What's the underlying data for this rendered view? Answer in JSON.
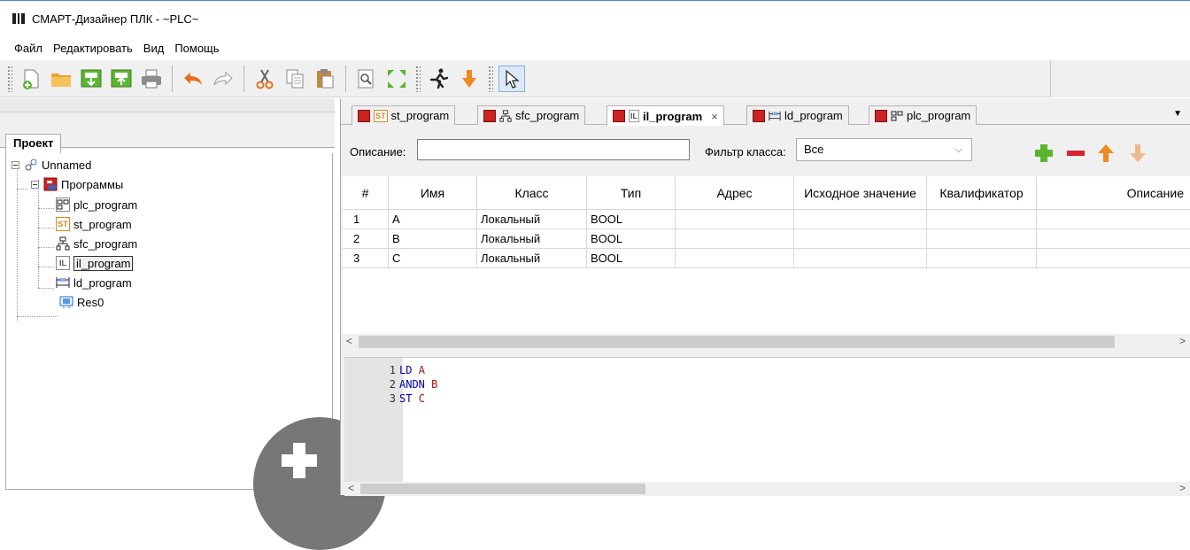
{
  "window": {
    "title": "СМАРТ-Дизайнер ПЛК - ~PLC~"
  },
  "menu": [
    "Файл",
    "Редактировать",
    "Вид",
    "Помощь"
  ],
  "toolbar": {
    "buttons": [
      "new-file-icon",
      "open-folder-icon",
      "download-icon",
      "upload-icon",
      "print-icon",
      "undo-icon",
      "redo-icon",
      "cut-icon",
      "copy-icon",
      "paste-icon",
      "find-icon",
      "fullscreen-icon",
      "run-icon",
      "step-down-icon",
      "pointer-icon"
    ]
  },
  "project_panel": {
    "tab_label": "Проект",
    "tree": {
      "root": "Unnamed",
      "programs_folder": "Программы",
      "programs": [
        {
          "label": "plc_program",
          "icon": "fbd-icon"
        },
        {
          "label": "st_program",
          "icon": "st-icon"
        },
        {
          "label": "sfc_program",
          "icon": "sfc-icon"
        },
        {
          "label": "il_program",
          "icon": "il-icon",
          "selected": true
        },
        {
          "label": "ld_program",
          "icon": "ld-icon"
        }
      ],
      "resource": "Res0"
    }
  },
  "doc_tabs": [
    {
      "label": "st_program",
      "badge": "ST",
      "active": false
    },
    {
      "label": "sfc_program",
      "badge": "SFC",
      "active": false
    },
    {
      "label": "il_program",
      "badge": "IL",
      "active": true,
      "close": "×"
    },
    {
      "label": "ld_program",
      "badge": "LD",
      "active": false
    },
    {
      "label": "plc_program",
      "badge": "FBD",
      "active": false
    }
  ],
  "filter": {
    "description_label": "Описание:",
    "description_value": "",
    "class_filter_label": "Фильтр класса:",
    "class_filter_value": "Все"
  },
  "variables_table": {
    "columns": [
      "#",
      "Имя",
      "Класс",
      "Тип",
      "Адрес",
      "Исходное значение",
      "Квалификатор",
      "Описание"
    ],
    "rows": [
      [
        "1",
        "A",
        "Локальный",
        "BOOL",
        "",
        "",
        "",
        ""
      ],
      [
        "2",
        "B",
        "Локальный",
        "BOOL",
        "",
        "",
        "",
        ""
      ],
      [
        "3",
        "C",
        "Локальный",
        "BOOL",
        "",
        "",
        "",
        ""
      ]
    ]
  },
  "code_editor": {
    "lines": [
      {
        "num": "1",
        "op": "LD",
        "arg": "A"
      },
      {
        "num": "2",
        "op": "ANDN",
        "arg": "B"
      },
      {
        "num": "3",
        "op": "ST",
        "arg": "C"
      }
    ]
  },
  "colors": {
    "accent_green": "#5cb531",
    "accent_red": "#d9232f",
    "accent_orange": "#ef8a1f",
    "disabled_orange": "#f0b88a"
  }
}
